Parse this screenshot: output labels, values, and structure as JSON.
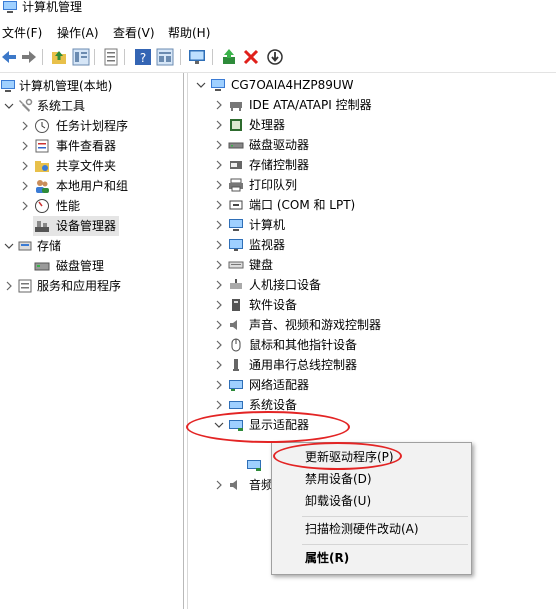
{
  "window": {
    "title": "计算机管理"
  },
  "menu": [
    "文件(F)",
    "操作(A)",
    "查看(V)",
    "帮助(H)"
  ],
  "toolbar": [
    "back-icon",
    "forward-icon",
    "up-folder-icon",
    "show-hide-tree-icon",
    "properties-icon",
    "help-icon",
    "details-icon",
    "monitor-icon",
    "update-driver-icon",
    "uninstall-icon",
    "scan-icon"
  ],
  "left_tree": {
    "root": "计算机管理(本地)",
    "system_tools": "系统工具",
    "task_scheduler": "任务计划程序",
    "event_viewer": "事件查看器",
    "shared_folders": "共享文件夹",
    "local_users": "本地用户和组",
    "performance": "性能",
    "device_manager": "设备管理器",
    "storage": "存储",
    "disk_mgmt": "磁盘管理",
    "services": "服务和应用程序"
  },
  "device_tree": {
    "computer_name": "CG7OAIA4HZP89UW",
    "items": [
      "IDE ATA/ATAPI 控制器",
      "处理器",
      "磁盘驱动器",
      "存储控制器",
      "打印队列",
      "端口 (COM 和 LPT)",
      "计算机",
      "监视器",
      "键盘",
      "人机接口设备",
      "软件设备",
      "声音、视频和游戏控制器",
      "鼠标和其他指针设备",
      "通用串行总线控制器",
      "网络适配器",
      "系统设备",
      "显示适配器"
    ],
    "partial_item": "音频"
  },
  "context_menu": {
    "update": "更新驱动程序(P)",
    "disable": "禁用设备(D)",
    "uninstall": "卸载设备(U)",
    "scan": "扫描检测硬件改动(A)",
    "properties": "属性(R)"
  },
  "colors": {
    "highlight": "#e32424",
    "selection": "#e5e5e5",
    "menu_bg": "#f2f2f2"
  }
}
